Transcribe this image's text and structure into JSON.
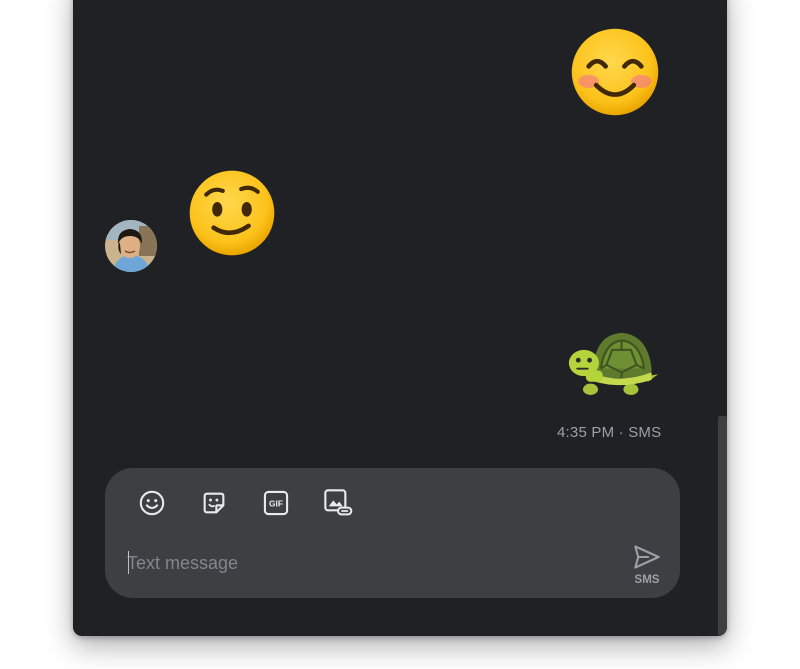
{
  "conversation": {
    "messages": [
      {
        "direction": "outgoing",
        "emoji": "smiling-face-with-smiling-eyes"
      },
      {
        "direction": "incoming",
        "emoji": "relieved-face"
      },
      {
        "direction": "outgoing",
        "emoji": "turtle"
      }
    ],
    "timestamp": "4:35 PM · SMS"
  },
  "composer": {
    "toolbar": [
      {
        "icon": "emoji-icon"
      },
      {
        "icon": "sticker-icon"
      },
      {
        "icon": "gif-icon"
      },
      {
        "icon": "attach-image-icon"
      }
    ],
    "gif_glyph": "GIF",
    "placeholder": "Text message",
    "value": "",
    "send_label": "SMS"
  },
  "colors": {
    "background": "#202124",
    "composer": "#3c4043",
    "icon": "#e8eaed",
    "muted_text": "#9aa0a6",
    "emoji_yellow": "#fcc21b",
    "turtle_green": "#b5d33b"
  }
}
